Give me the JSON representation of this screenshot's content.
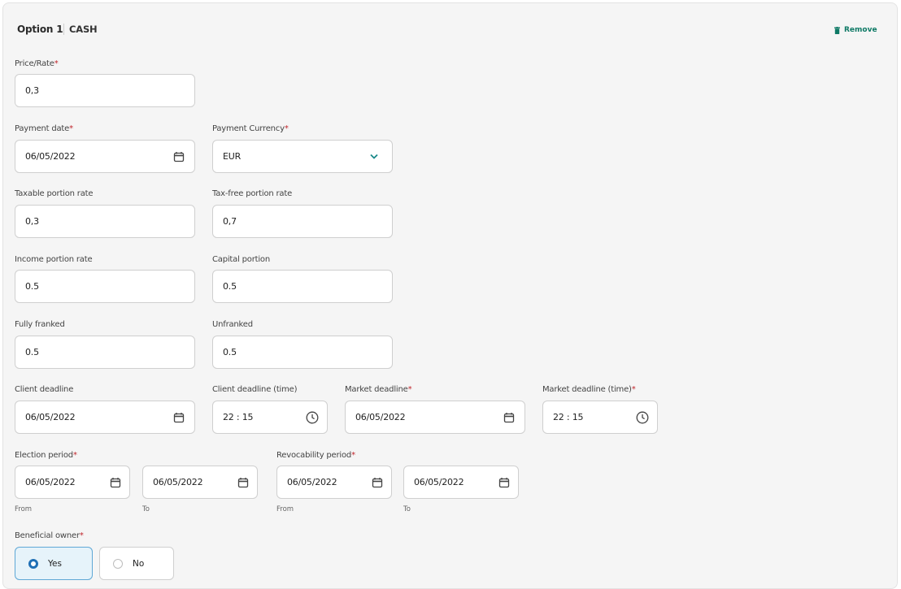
{
  "header": {
    "title": "Option 1",
    "type": "CASH",
    "remove_label": "Remove"
  },
  "colors": {
    "accent": "#0f7a66",
    "required": "#c0272d",
    "selected": "#1f6fb5"
  },
  "fields": {
    "price_rate": {
      "label": "Price/Rate",
      "required": "*",
      "value": "0,3"
    },
    "payment_date": {
      "label": "Payment date",
      "required": "*",
      "value": "06/05/2022"
    },
    "payment_currency": {
      "label": "Payment Currency",
      "required": "*",
      "value": "EUR"
    },
    "taxable_rate": {
      "label": "Taxable portion rate",
      "value": "0,3"
    },
    "taxfree_rate": {
      "label": "Tax-free portion rate",
      "value": "0,7"
    },
    "income_rate": {
      "label": "Income portion rate",
      "value": "0.5"
    },
    "capital_portion": {
      "label": "Capital portion",
      "value": "0.5"
    },
    "fully_franked": {
      "label": "Fully franked",
      "value": "0.5"
    },
    "unfranked": {
      "label": "Unfranked",
      "value": "0.5"
    },
    "client_deadline": {
      "label": "Client deadline",
      "value": "06/05/2022"
    },
    "client_deadline_time": {
      "label": "Client deadline (time)",
      "value": "22 : 15"
    },
    "market_deadline": {
      "label": "Market deadline",
      "required": "*",
      "value": "06/05/2022"
    },
    "market_deadline_time": {
      "label": "Market deadline  (time)",
      "required": "*",
      "value": "22 : 15"
    },
    "election_period": {
      "label": "Election period",
      "required": "*",
      "from_value": "06/05/2022",
      "to_value": "06/05/2022",
      "from_label": "From",
      "to_label": "To"
    },
    "revocability_period": {
      "label": "Revocability period",
      "required": "*",
      "from_value": "06/05/2022",
      "to_value": "06/05/2022",
      "from_label": "From",
      "to_label": "To"
    },
    "beneficial_owner": {
      "label": "Beneficial owner",
      "required": "*",
      "options": [
        "Yes",
        "No"
      ],
      "selected": "Yes"
    }
  },
  "icons": {
    "calendar": "calendar-icon",
    "clock": "clock-icon",
    "chevron": "chevron-down-icon",
    "trash": "trash-icon"
  }
}
